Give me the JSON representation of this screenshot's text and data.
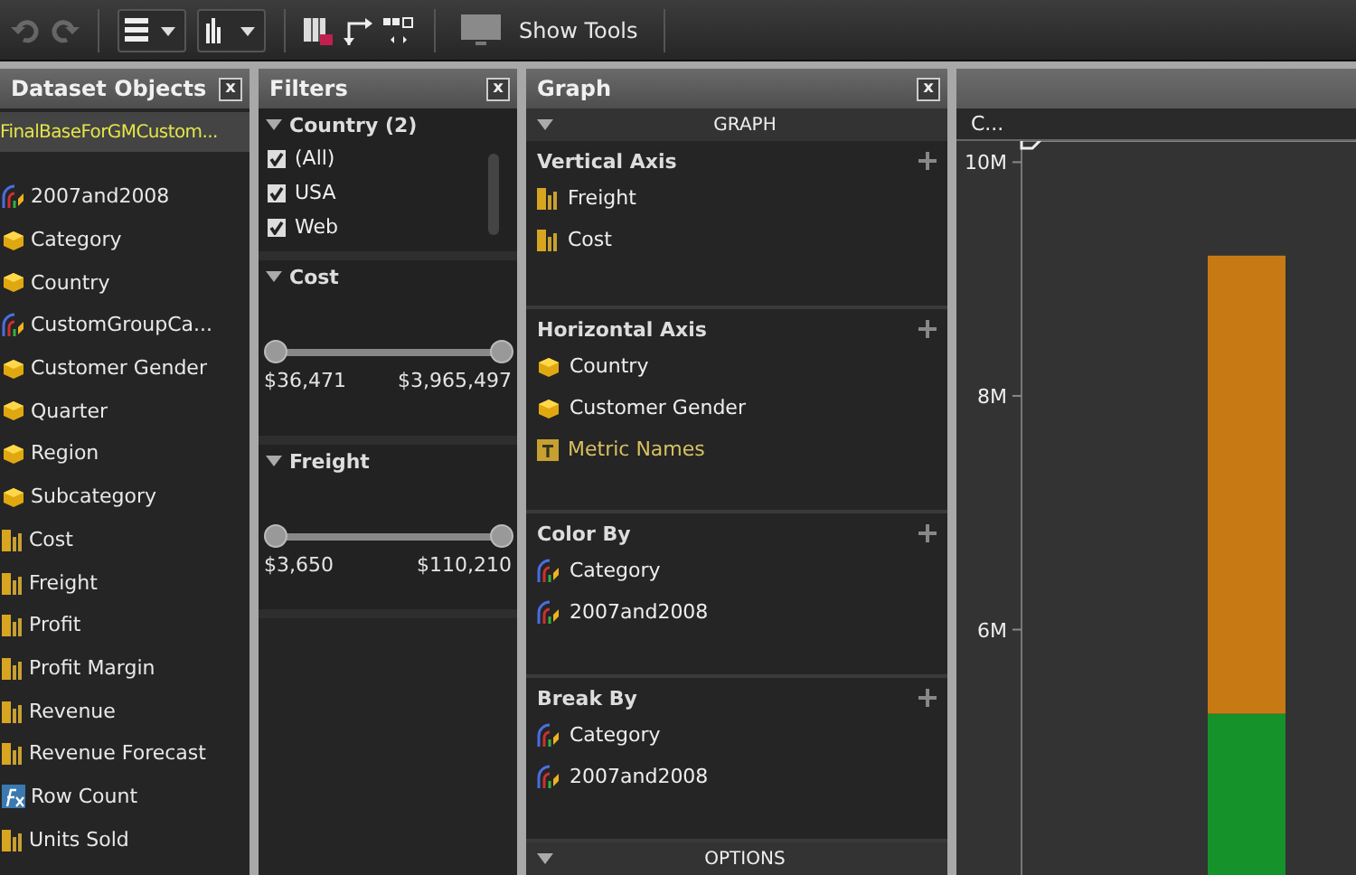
{
  "toolbar": {
    "undo_disabled": true,
    "redo_disabled": true,
    "show_tools": "Show Tools"
  },
  "dataset": {
    "title": "Dataset Objects",
    "close": "x",
    "items": [
      {
        "label": "FinalBaseForGMCustom...",
        "kind": "source",
        "selected": true
      },
      {
        "label": "2007and2008",
        "kind": "group",
        "selected": false
      },
      {
        "label": "Category",
        "kind": "attribute",
        "selected": false
      },
      {
        "label": "Country",
        "kind": "attribute",
        "selected": false
      },
      {
        "label": "CustomGroupCa...",
        "kind": "group",
        "selected": false
      },
      {
        "label": "Customer Gender",
        "kind": "attribute",
        "selected": false
      },
      {
        "label": "Quarter",
        "kind": "attribute",
        "selected": false
      },
      {
        "label": "Region",
        "kind": "attribute",
        "selected": false
      },
      {
        "label": "Subcategory",
        "kind": "attribute",
        "selected": false
      },
      {
        "label": "Cost",
        "kind": "metric",
        "selected": false
      },
      {
        "label": "Freight",
        "kind": "metric",
        "selected": false
      },
      {
        "label": "Profit",
        "kind": "metric",
        "selected": false
      },
      {
        "label": "Profit Margin",
        "kind": "metric",
        "selected": false
      },
      {
        "label": "Revenue",
        "kind": "metric",
        "selected": false
      },
      {
        "label": "Revenue Forecast",
        "kind": "metric",
        "selected": false
      },
      {
        "label": "Row Count",
        "kind": "formula",
        "selected": false
      },
      {
        "label": "Units Sold",
        "kind": "metric",
        "selected": false
      }
    ]
  },
  "filters": {
    "title": "Filters",
    "close": "x",
    "sections": [
      {
        "kind": "checklist",
        "title": "Country (2)",
        "expanded": true,
        "options": [
          {
            "label": "(All)",
            "checked": true
          },
          {
            "label": "USA",
            "checked": true
          },
          {
            "label": "Web",
            "checked": true
          }
        ]
      },
      {
        "kind": "range",
        "title": "Cost",
        "expanded": true,
        "thumbs": [
          {
            "level": 0
          },
          {
            "level": 1
          }
        ],
        "min": "$36,471",
        "max": "$3,965,497"
      },
      {
        "kind": "range",
        "title": "Freight",
        "expanded": true,
        "thumbs": [
          {
            "level": 0
          },
          {
            "level": 1
          }
        ],
        "min": "$3,650",
        "max": "$110,210"
      }
    ]
  },
  "graph": {
    "title": "Graph",
    "close": "x",
    "section_header": "GRAPH",
    "zones": [
      {
        "title": "Vertical Axis",
        "items": [
          {
            "label": "Freight",
            "kind": "metric"
          },
          {
            "label": "Cost",
            "kind": "metric"
          }
        ]
      },
      {
        "title": "Horizontal Axis",
        "items": [
          {
            "label": "Country",
            "kind": "attribute"
          },
          {
            "label": "Customer Gender",
            "kind": "attribute"
          },
          {
            "label": "Metric Names",
            "kind": "metric_names"
          }
        ]
      },
      {
        "title": "Color By",
        "items": [
          {
            "label": "Category",
            "kind": "group"
          },
          {
            "label": "2007and2008",
            "kind": "group"
          }
        ]
      },
      {
        "title": "Break By",
        "items": [
          {
            "label": "Category",
            "kind": "group"
          },
          {
            "label": "2007and2008",
            "kind": "group"
          }
        ]
      }
    ],
    "options_header": "OPTIONS"
  },
  "canvas": {
    "column_label": "C...",
    "chart_data": {
      "type": "bar",
      "stacked": true,
      "categories": [
        null
      ],
      "series": [
        {
          "color": "#c77a14",
          "values": [
            3920000
          ]
        },
        {
          "color": "#15922a",
          "values": [
            5280000
          ]
        }
      ],
      "ylim": [
        3900000,
        10181000
      ],
      "yticks": [
        {
          "value": 6000000,
          "label": "6M"
        },
        {
          "value": 8000000,
          "label": "8M"
        },
        {
          "value": 10000000,
          "label": "10M"
        }
      ]
    }
  }
}
